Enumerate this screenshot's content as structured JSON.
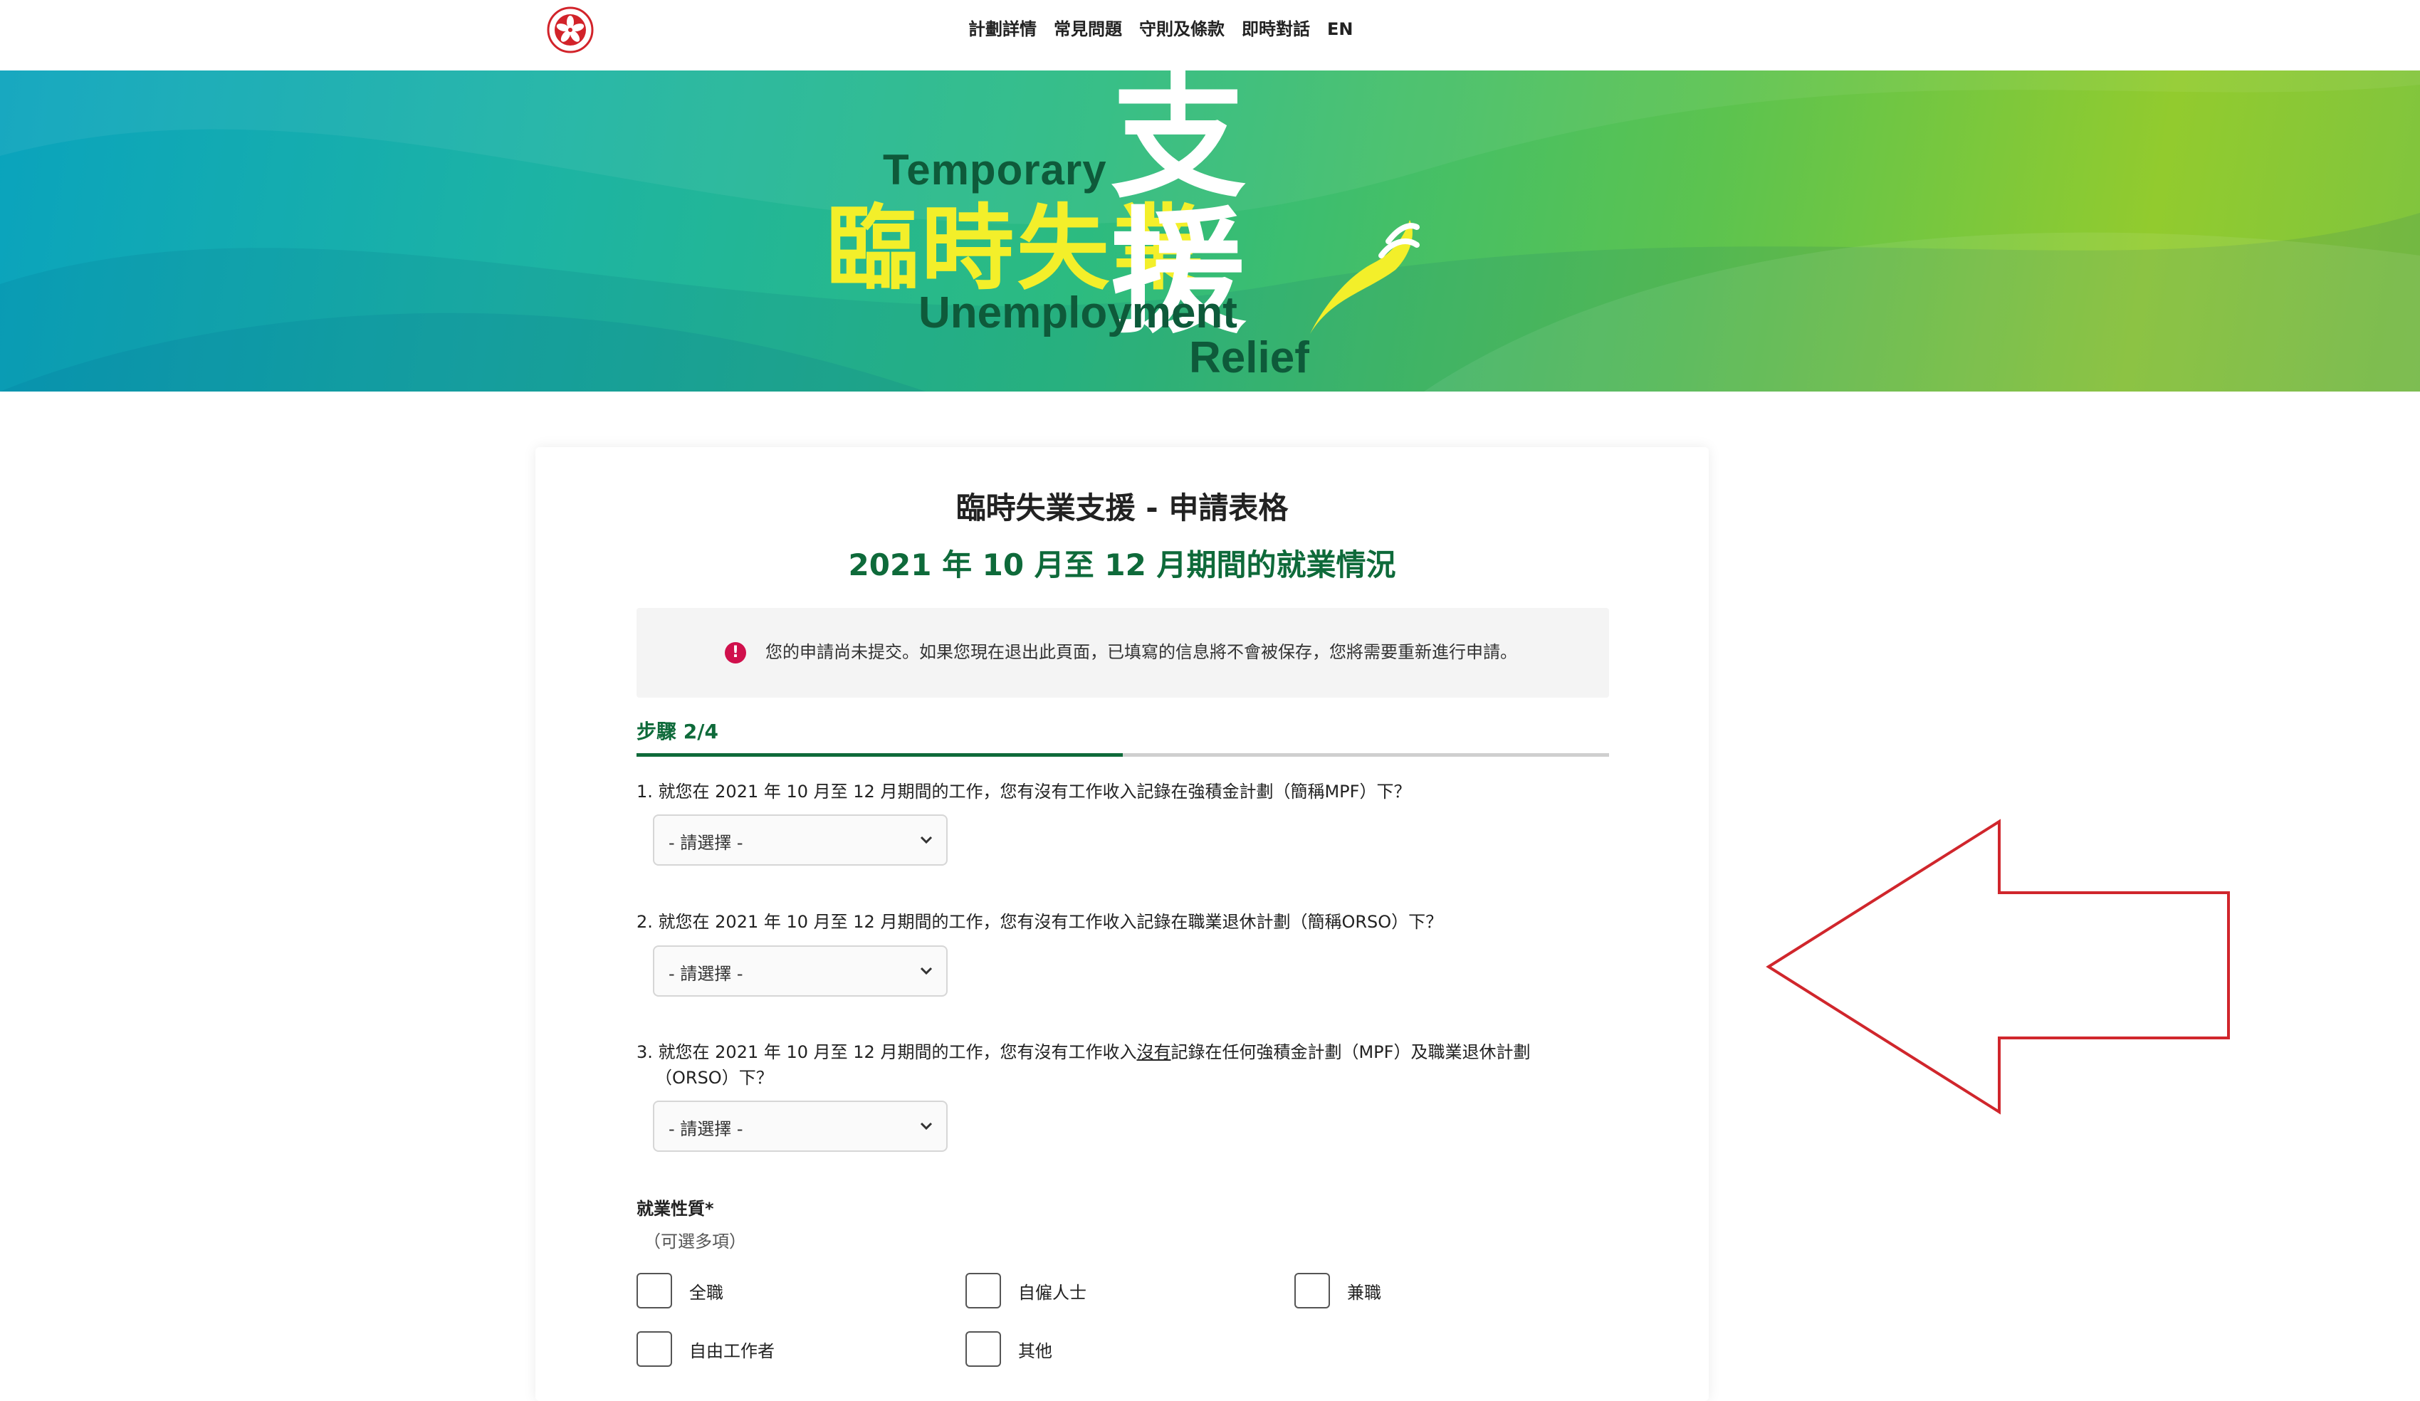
{
  "nav": {
    "items": [
      "計劃詳情",
      "常見問題",
      "守則及條款",
      "即時對話",
      "EN"
    ]
  },
  "banner": {
    "logo_en_line1": "Temporary",
    "logo_cn_main": "臨時失業",
    "logo_cn_support": "支援",
    "logo_en_line2": "Unemployment",
    "logo_en_line3": "Relief"
  },
  "form": {
    "title": "臨時失業支援 - 申請表格",
    "subtitle": "2021 年 10 月至 12 月期間的就業情況",
    "notice": "您的申請尚未提交。如果您現在退出此頁面，已填寫的信息將不會被保存，您將需要重新進行申請。",
    "notice_icon": "!",
    "step_label": "步驟 2/4",
    "progress_fraction": 0.5,
    "questions": [
      {
        "text": "1. 就您在 2021 年 10 月至 12 月期間的工作，您有沒有工作收入記錄在強積金計劃（簡稱MPF）下？",
        "select_value": "- 請選擇 -"
      },
      {
        "text": "2. 就您在 2021 年 10 月至 12 月期間的工作，您有沒有工作收入記錄在職業退休計劃（簡稱ORSO）下？",
        "select_value": "- 請選擇 -"
      },
      {
        "text_before": "3. 就您在 2021 年 10 月至 12 月期間的工作，您有沒有工作收入",
        "text_underlined": "沒有",
        "text_after": "記錄在任何強積金計劃（MPF）及職業退休計劃",
        "text_line2": "（ORSO）下？",
        "select_value": "- 請選擇 -"
      }
    ],
    "employment_label": "就業性質*",
    "employment_hint": "（可選多項）",
    "employment_options": [
      "全職",
      "自僱人士",
      "兼職",
      "自由工作者",
      "其他"
    ]
  },
  "colors": {
    "brand_green": "#0e6a3a",
    "warning": "#d0104c",
    "annotation_arrow": "#d0262c"
  },
  "icons": {
    "emblem": "hksar-emblem-icon",
    "warning": "warning-icon",
    "chevron": "chevron-down-icon",
    "annotation": "arrow-left-outline-icon"
  }
}
